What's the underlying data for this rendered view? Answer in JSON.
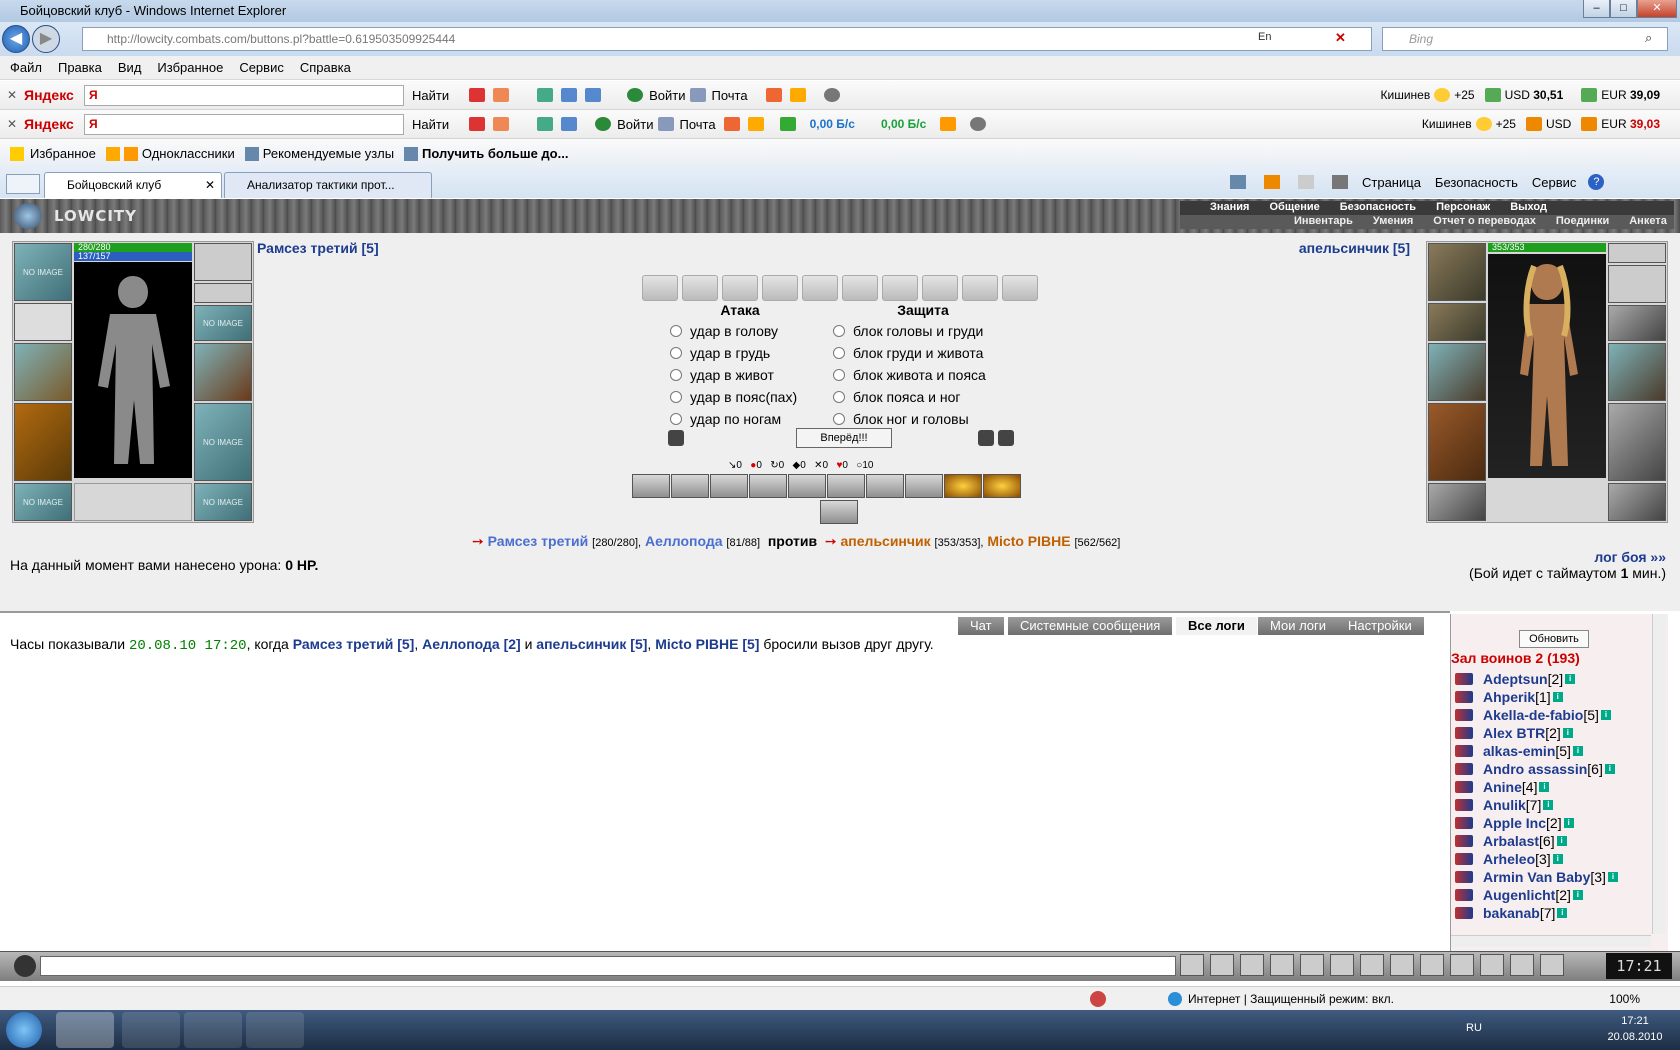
{
  "window": {
    "title": "Бойцовский клуб - Windows Internet Explorer"
  },
  "address": {
    "url": "http://lowcity.combats.com/buttons.pl?battle=0.619503509925444",
    "lang": "En",
    "search_placeholder": "Bing"
  },
  "menu": [
    "Файл",
    "Правка",
    "Вид",
    "Избранное",
    "Сервис",
    "Справка"
  ],
  "yandex1": {
    "logo": "Яндекс",
    "input": "Я",
    "find": "Найти",
    "login": "Войти",
    "mail": "Почта",
    "city": "Кишинев",
    "temp": "+25",
    "usd_label": "USD",
    "usd": "30,51",
    "eur_label": "EUR",
    "eur": "39,09"
  },
  "yandex2": {
    "logo": "Яндекс",
    "input": "Я",
    "find": "Найти",
    "login": "Войти",
    "mail": "Почта",
    "speed1": "0,00 Б/с",
    "speed2": "0,00 Б/с",
    "city": "Кишинев",
    "temp": "+25",
    "usd_label": "USD",
    "eur_label": "EUR",
    "eur": "39,03"
  },
  "favorites": {
    "fav": "Избранное",
    "ok": "Одноклассники",
    "rec": "Рекомендуемые узлы",
    "more": "Получить больше до..."
  },
  "tabs": [
    {
      "label": "Бойцовский клуб"
    },
    {
      "label": "Анализатор тактики прот..."
    }
  ],
  "commands": {
    "page": "Страница",
    "security": "Безопасность",
    "service": "Сервис"
  },
  "game": {
    "logo": "LOWCITY",
    "nav_top": [
      "Знания",
      "Общение",
      "Безопасность",
      "Персонаж",
      "Выход"
    ],
    "nav_bottom": [
      "Инвентарь",
      "Умения",
      "Отчет о переводах",
      "Поединки",
      "Анкета"
    ],
    "player_left": {
      "name": "Рамсез третий [5]",
      "hp": "280/280",
      "mana": "137/157",
      "noimage": "NO IMAGE"
    },
    "player_right": {
      "name": "апельсинчик [5]",
      "hp": "353/353"
    },
    "attack_title": "Атака",
    "defense_title": "Защита",
    "attacks": [
      "удар в голову",
      "удар в грудь",
      "удар в живот",
      "удар в пояс(пах)",
      "удар по ногам"
    ],
    "defenses": [
      "блок головы и груди",
      "блок груди и живота",
      "блок живота и пояса",
      "блок пояса и ног",
      "блок ног и головы"
    ],
    "forward": "Вперёд!!!",
    "counters": [
      "0",
      "0",
      "0",
      "0",
      "0",
      "0",
      "10"
    ],
    "teams": {
      "p1": "Рамсез третий",
      "p1hp": "[280/280],",
      "p2": "Аеллопода",
      "p2hp": "[81/88]",
      "vs": "против",
      "p3": "апельсинчик",
      "p3hp": "[353/353],",
      "p4": "Micto PIBHE",
      "p4hp": "[562/562]"
    },
    "damage_label": "На данный момент вами нанесено урона:",
    "damage_value": "0 HP.",
    "log_link": "лог боя »»",
    "timeout": "(Бой идет с таймаутом ",
    "timeout_n": "1",
    "timeout_unit": " мин.)"
  },
  "logtabs": [
    "Чат",
    "Системные сообщения",
    "Все логи",
    "Мои логи",
    "Настройки"
  ],
  "log": {
    "pre": "Часы показывали ",
    "time": "20.08.10 17:20",
    "when": ", когда ",
    "n1": "Рамсез третий [5]",
    "c1": ", ",
    "n2": "Аеллопода [2]",
    "and": " и ",
    "n3": "апельсинчик [5]",
    "c2": ", ",
    "n4": "Micto PIBHE [5]",
    "post": " бросили вызов друг другу."
  },
  "room": {
    "refresh": "Обновить",
    "title": "Зал воинов 2 (193)",
    "users": [
      {
        "n": "Adeptsun",
        "l": "[2]"
      },
      {
        "n": "Ahperik",
        "l": "[1]"
      },
      {
        "n": "Akella-de-fabio",
        "l": "[5]"
      },
      {
        "n": "Alex BTR",
        "l": "[2]"
      },
      {
        "n": "alkas-emin",
        "l": "[5]"
      },
      {
        "n": "Andro assassin",
        "l": "[6]"
      },
      {
        "n": "Anine",
        "l": "[4]"
      },
      {
        "n": "Anulik",
        "l": "[7]"
      },
      {
        "n": "Apple Inc",
        "l": "[2]"
      },
      {
        "n": "Arbalast",
        "l": "[6]"
      },
      {
        "n": "Arheleo",
        "l": "[3]"
      },
      {
        "n": "Armin Van Baby",
        "l": "[3]"
      },
      {
        "n": "Augenlicht",
        "l": "[2]"
      },
      {
        "n": "bakanab",
        "l": "[7]"
      }
    ]
  },
  "status": {
    "zone": "Интернет | Защищенный режим: вкл.",
    "zoom": "100%"
  },
  "taskbar": {
    "lang": "RU",
    "time": "17:21",
    "date": "20.08.2010"
  },
  "clock": "17:21"
}
